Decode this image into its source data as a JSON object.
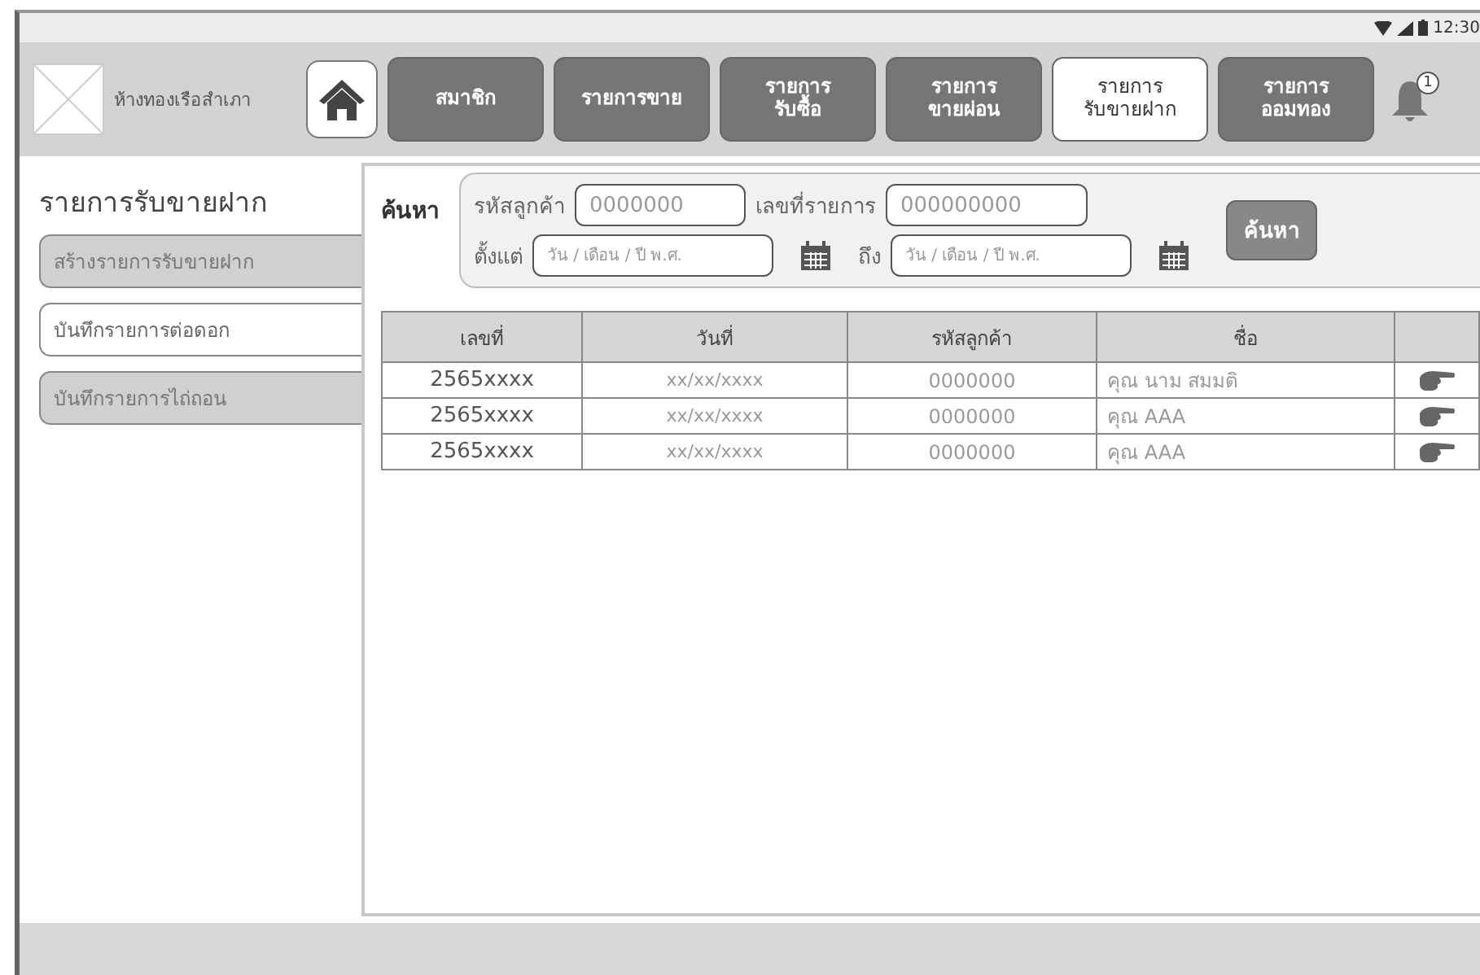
{
  "status_bar": {
    "time": "12:30"
  },
  "header": {
    "store_name": "ห้างทองเรือสำเภา",
    "notification_count": "1",
    "tabs": [
      {
        "label": "สมาชิก",
        "selected": false
      },
      {
        "label": "รายการขาย",
        "selected": false
      },
      {
        "label": "รายการ\nรับซื้อ",
        "selected": false
      },
      {
        "label": "รายการ\nขายผ่อน",
        "selected": false
      },
      {
        "label": "รายการ\nรับขายฝาก",
        "selected": true
      },
      {
        "label": "รายการ\nออมทอง",
        "selected": false
      }
    ]
  },
  "sidebar": {
    "title": "รายการรับขายฝาก",
    "items": [
      {
        "label": "สร้างรายการรับขายฝาก",
        "selected": false
      },
      {
        "label": "บันทึกรายการต่อดอก",
        "selected": true
      },
      {
        "label": "บันทึกรายการไถ่ถอน",
        "selected": false
      }
    ]
  },
  "search": {
    "title": "ค้นหา",
    "customer_label": "รหัสลูกค้า",
    "customer_placeholder": "0000000",
    "number_label": "เลขที่รายการ",
    "number_placeholder": "000000000",
    "from_label": "ตั้งแต่",
    "from_placeholder": "วัน / เดือน / ปี พ.ศ.",
    "to_label": "ถึง",
    "to_placeholder": "วัน / เดือน / ปี พ.ศ.",
    "button": "ค้นหา"
  },
  "table": {
    "columns": [
      "เลขที่",
      "วันที่",
      "รหัสลูกค้า",
      "ชื่อ"
    ],
    "rows": [
      {
        "number": "2565xxxx",
        "date": "xx/xx/xxxx",
        "customer_id": "0000000",
        "name": "คุณ นาม สมมติ"
      },
      {
        "number": "2565xxxx",
        "date": "xx/xx/xxxx",
        "customer_id": "0000000",
        "name": "คุณ AAA"
      },
      {
        "number": "2565xxxx",
        "date": "xx/xx/xxxx",
        "customer_id": "0000000",
        "name": "คุณ AAA"
      }
    ]
  }
}
